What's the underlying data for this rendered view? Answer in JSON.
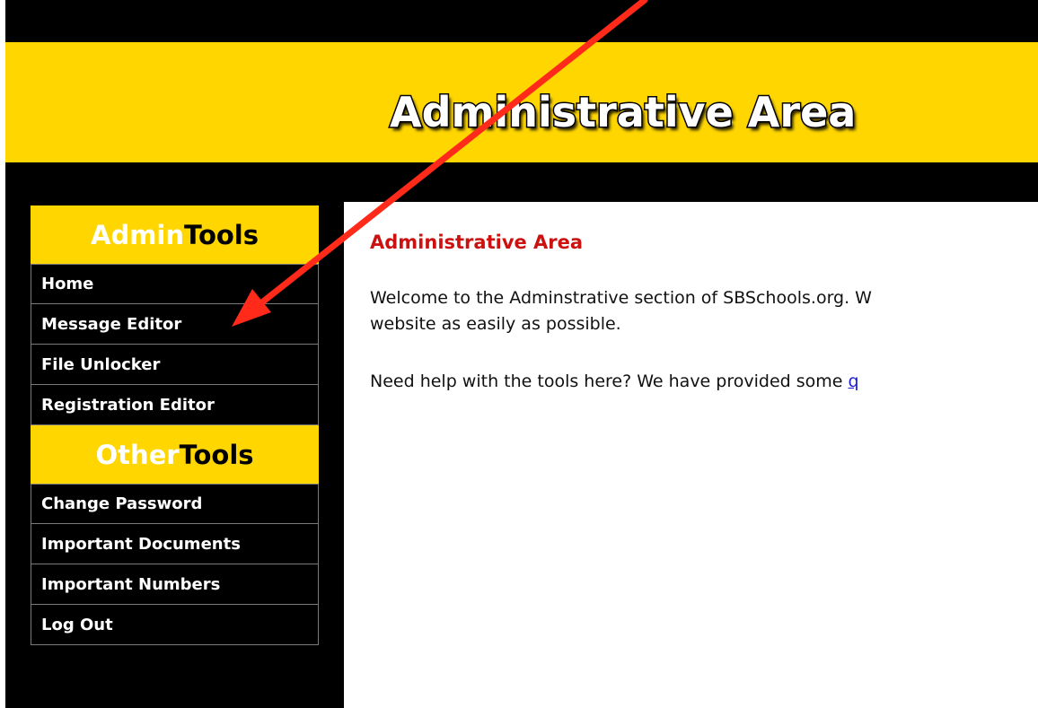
{
  "banner": {
    "title": "Administrative Area"
  },
  "sidebar": {
    "admin_header": {
      "part1": "Admin",
      "part2": "Tools"
    },
    "admin_items": [
      {
        "label": "Home"
      },
      {
        "label": "Message Editor"
      },
      {
        "label": "File Unlocker"
      },
      {
        "label": "Registration Editor"
      }
    ],
    "other_header": {
      "part1": "Other",
      "part2": "Tools"
    },
    "other_items": [
      {
        "label": "Change Password"
      },
      {
        "label": "Important Documents"
      },
      {
        "label": "Important Numbers"
      },
      {
        "label": "Log Out"
      }
    ]
  },
  "main": {
    "title": "Administrative Area",
    "para1_line1": "Welcome to the Adminstrative section of SBSchools.org. W",
    "para1_line2": "website as easily as possible.",
    "para2_text": "Need help with the tools here? We have provided some ",
    "para2_link": "q"
  },
  "annotation": {
    "arrow_color": "#ff2a1a"
  },
  "colors": {
    "accent_yellow": "#ffd600",
    "heading_red": "#cc1111",
    "link_blue": "#1a1ad6"
  }
}
